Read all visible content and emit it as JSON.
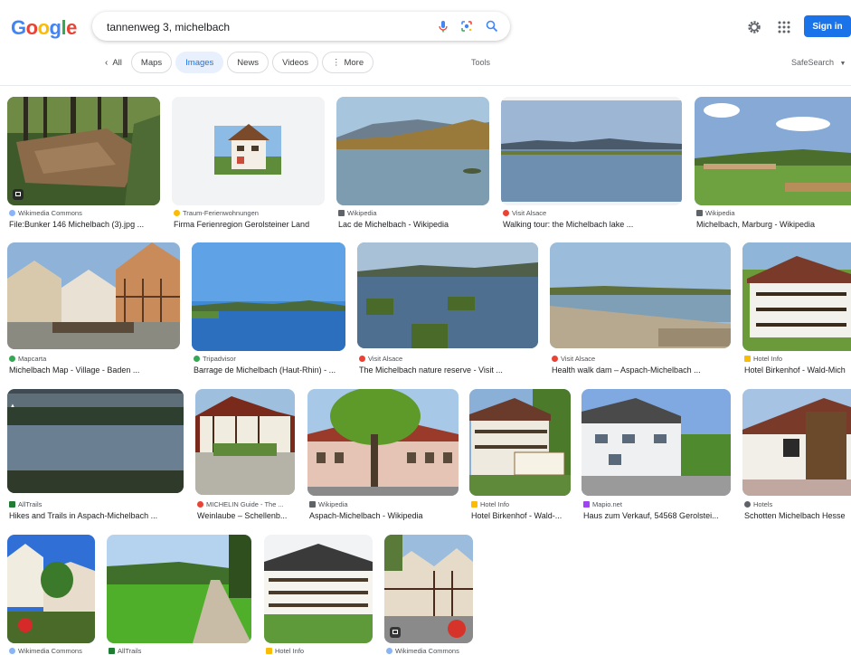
{
  "logo": "Google",
  "search": {
    "query": "tannenweg 3, michelbach"
  },
  "header": {
    "signin_label": "Sign in"
  },
  "tabs": [
    {
      "label": "All"
    },
    {
      "label": "Maps"
    },
    {
      "label": "Images"
    },
    {
      "label": "News"
    },
    {
      "label": "Videos"
    },
    {
      "label": "More"
    }
  ],
  "tools_label": "Tools",
  "safesearch_label": "SafeSearch",
  "colors": {
    "accent": "#1a73e8",
    "active_tab_bg": "#e8f0fe"
  },
  "results": [
    {
      "source": "Wikimedia Commons",
      "title": "File:Bunker 146 Michelbach (3).jpg ..."
    },
    {
      "source": "Traum-Ferienwohnungen",
      "title": "Firma Ferienregion Gerolsteiner Land"
    },
    {
      "source": "Wikipedia",
      "title": "Lac de Michelbach - Wikipedia"
    },
    {
      "source": "Visit Alsace",
      "title": "Walking tour: the Michelbach lake ..."
    },
    {
      "source": "Wikipedia",
      "title": "Michelbach, Marburg - Wikipedia"
    },
    {
      "source": "Mapcarta",
      "title": "Michelbach Map - Village - Baden ..."
    },
    {
      "source": "Tripadvisor",
      "title": "Barrage de Michelbach (Haut-Rhin) - ..."
    },
    {
      "source": "Visit Alsace",
      "title": "The Michelbach nature reserve - Visit ..."
    },
    {
      "source": "Visit Alsace",
      "title": "Health walk dam – Aspach-Michelbach ..."
    },
    {
      "source": "Hotel Info",
      "title": "Hotel Birkenhof - Wald-Mich"
    },
    {
      "source": "AllTrails",
      "title": "Hikes and Trails in Aspach-Michelbach ..."
    },
    {
      "source": "MICHELIN Guide - The ...",
      "title": "Weinlaube – Schellenb..."
    },
    {
      "source": "Wikipedia",
      "title": "Aspach-Michelbach - Wikipedia"
    },
    {
      "source": "Hotel Info",
      "title": "Hotel Birkenhof - Wald-..."
    },
    {
      "source": "Mapio.net",
      "title": "Haus zum Verkauf, 54568 Gerolstei..."
    },
    {
      "source": "Hotels",
      "title": "Schotten Michelbach Hesse"
    },
    {
      "source": "Wikimedia Commons",
      "title": ""
    },
    {
      "source": "AllTrails",
      "title": ""
    },
    {
      "source": "Hotel Info",
      "title": ""
    },
    {
      "source": "Wikimedia Commons",
      "title": ""
    }
  ]
}
